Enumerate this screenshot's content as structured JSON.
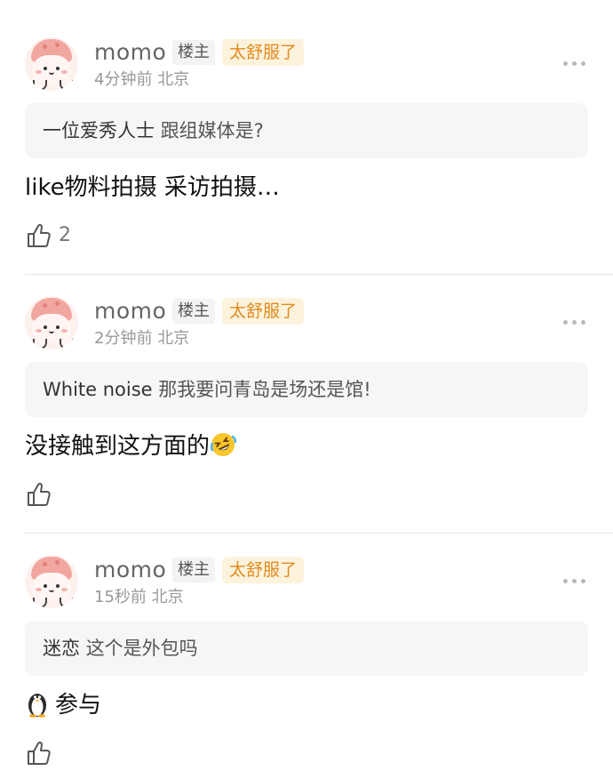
{
  "comments": [
    {
      "username": "momo",
      "owner_badge": "楼主",
      "status_badge": "太舒服了",
      "time": "4分钟前",
      "location": "北京",
      "quote_author": "一位爱秀人士",
      "quote_text": "跟组媒体是?",
      "body": "like物料拍摄 采访拍摄…",
      "likes": "2"
    },
    {
      "username": "momo",
      "owner_badge": "楼主",
      "status_badge": "太舒服了",
      "time": "2分钟前",
      "location": "北京",
      "quote_author": "White noise",
      "quote_text": "那我要问青岛是场还是馆!",
      "body": "没接触到这方面的",
      "body_emoji": "rolling-on-floor-laughing-emoji",
      "likes": ""
    },
    {
      "username": "momo",
      "owner_badge": "楼主",
      "status_badge": "太舒服了",
      "time": "15秒前",
      "location": "北京",
      "quote_author": "迷恋",
      "quote_text": "这个是外包吗",
      "body": "参与",
      "body_emoji": "penguin-emoji",
      "likes": ""
    }
  ],
  "icons": {
    "more": "more-dots-icon",
    "like": "thumbs-up-icon",
    "avatar": "pink-mushroom-avatar"
  },
  "colors": {
    "badge_text": "#e08a1e",
    "badge_bg": "#fdf3dc",
    "quote_bg": "#f6f6f6",
    "meta": "#999999"
  }
}
